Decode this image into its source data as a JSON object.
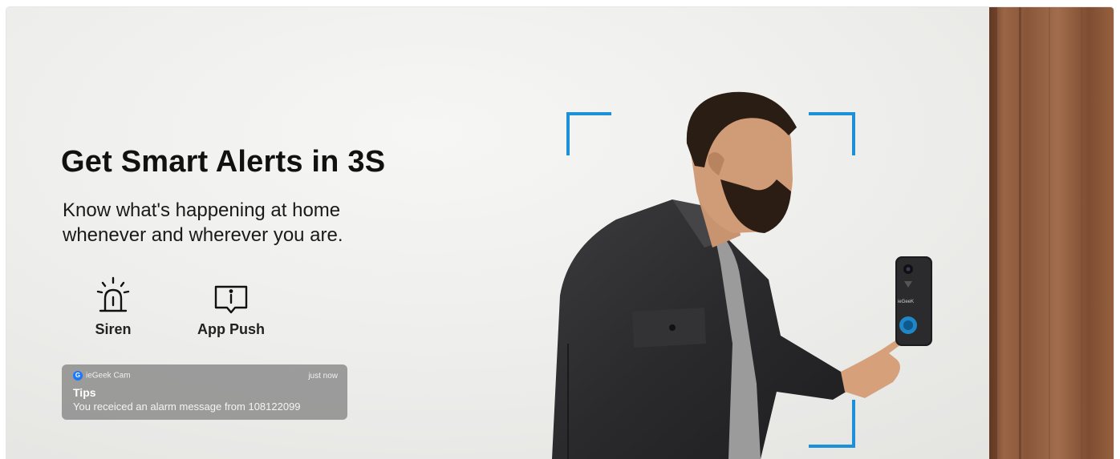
{
  "headline": "Get Smart Alerts in 3S",
  "subline": "Know what's happening at home whenever and wherever you are.",
  "features": [
    {
      "label": "Siren",
      "icon": "siren-icon"
    },
    {
      "label": "App Push",
      "icon": "app-push-icon"
    }
  ],
  "notification": {
    "app_icon_letter": "G",
    "app_name": "ieGeek Cam",
    "time": "just now",
    "title": "Tips",
    "message": "You receiced an alarm message from 108122099"
  },
  "doorbell": {
    "brand": "ieGeeK"
  },
  "colors": {
    "accent": "#1e90d8",
    "door": "#8a5a3c"
  }
}
